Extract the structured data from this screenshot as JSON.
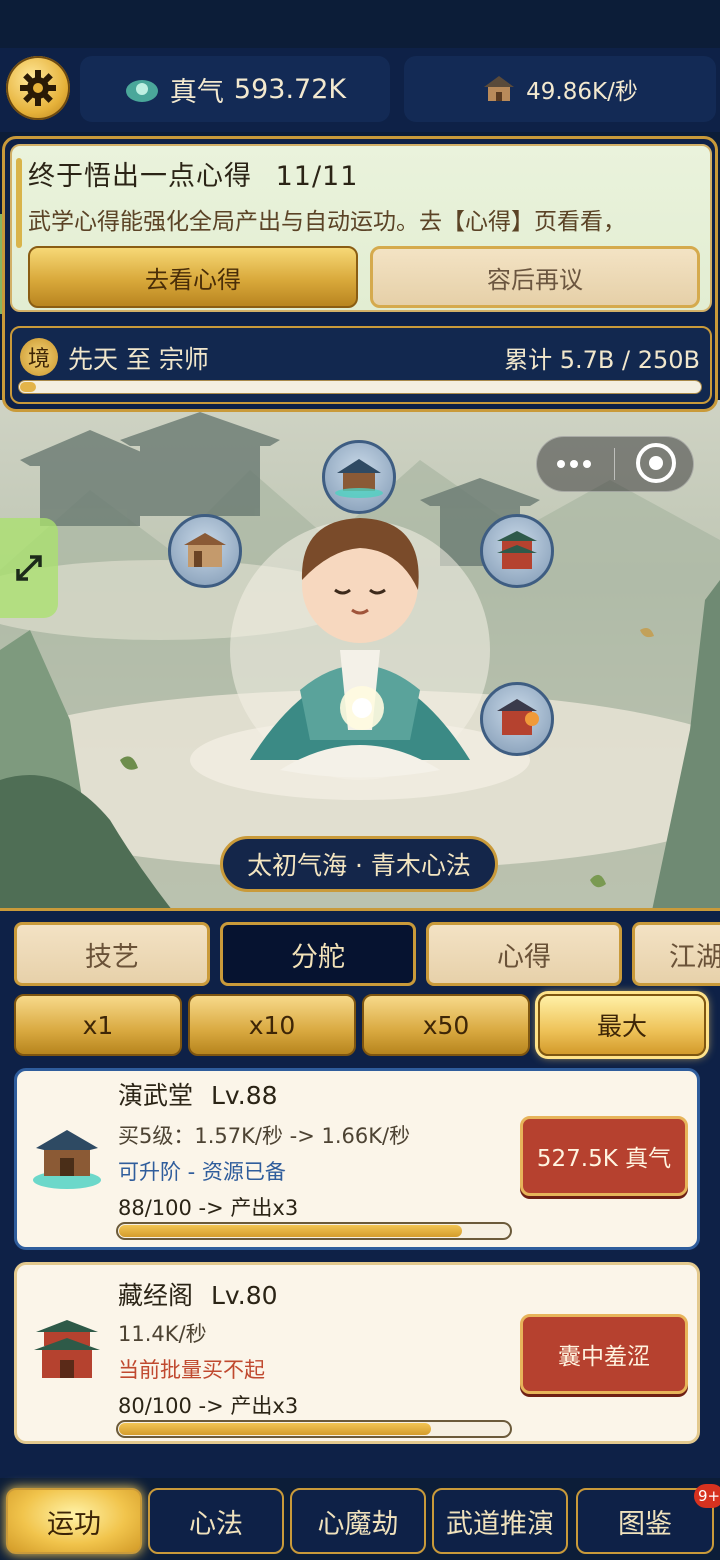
{
  "header": {
    "zhenqi_label": "真气",
    "zhenqi_value": "593.72K",
    "rate_value": "49.86K/秒",
    "icons": [
      "gear-icon",
      "qi-dragon-icon",
      "house-icon"
    ]
  },
  "quest": {
    "title": "终于悟出一点心得",
    "progress": "11/11",
    "description": "武学心得能强化全局产出与自动运功。去【心得】页看看，",
    "go_label": "去看心得",
    "later_label": "容后再议"
  },
  "realm": {
    "badge": "境",
    "text": "先天 至 宗师",
    "total": "累计 5.7B / 250B",
    "progress_fraction": 0.023
  },
  "scene": {
    "technique_label": "太初气海 · 青木心法"
  },
  "tabs": [
    {
      "label": "技艺",
      "active": false
    },
    {
      "label": "分舵",
      "active": true
    },
    {
      "label": "心得",
      "active": false
    },
    {
      "label": "江湖",
      "active": false
    }
  ],
  "multipliers": [
    {
      "label": "x1",
      "selected": false
    },
    {
      "label": "x10",
      "selected": false
    },
    {
      "label": "x50",
      "selected": false
    },
    {
      "label": "最大",
      "selected": true
    }
  ],
  "buildings": [
    {
      "name": "演武堂",
      "level": "Lv.88",
      "rate": "买5级：1.57K/秒 -> 1.66K/秒",
      "status": "可升阶 - 资源已备",
      "status_color": "#2f5d9c",
      "progress_text": "88/100 -> 产出x3",
      "progress_fraction": 0.88,
      "button_label": "527.5K 真气"
    },
    {
      "name": "藏经阁",
      "level": "Lv.80",
      "rate": "11.4K/秒",
      "status": "当前批量买不起",
      "status_color": "#c0492f",
      "progress_text": "80/100 -> 产出x3",
      "progress_fraction": 0.8,
      "button_label": "囊中羞涩"
    }
  ],
  "nav": [
    {
      "label": "运功",
      "active": true
    },
    {
      "label": "心法",
      "active": false
    },
    {
      "label": "心魔劫",
      "active": false
    },
    {
      "label": "武道推演",
      "active": false
    },
    {
      "label": "图鉴",
      "active": false
    }
  ],
  "nav_badge": "9+"
}
